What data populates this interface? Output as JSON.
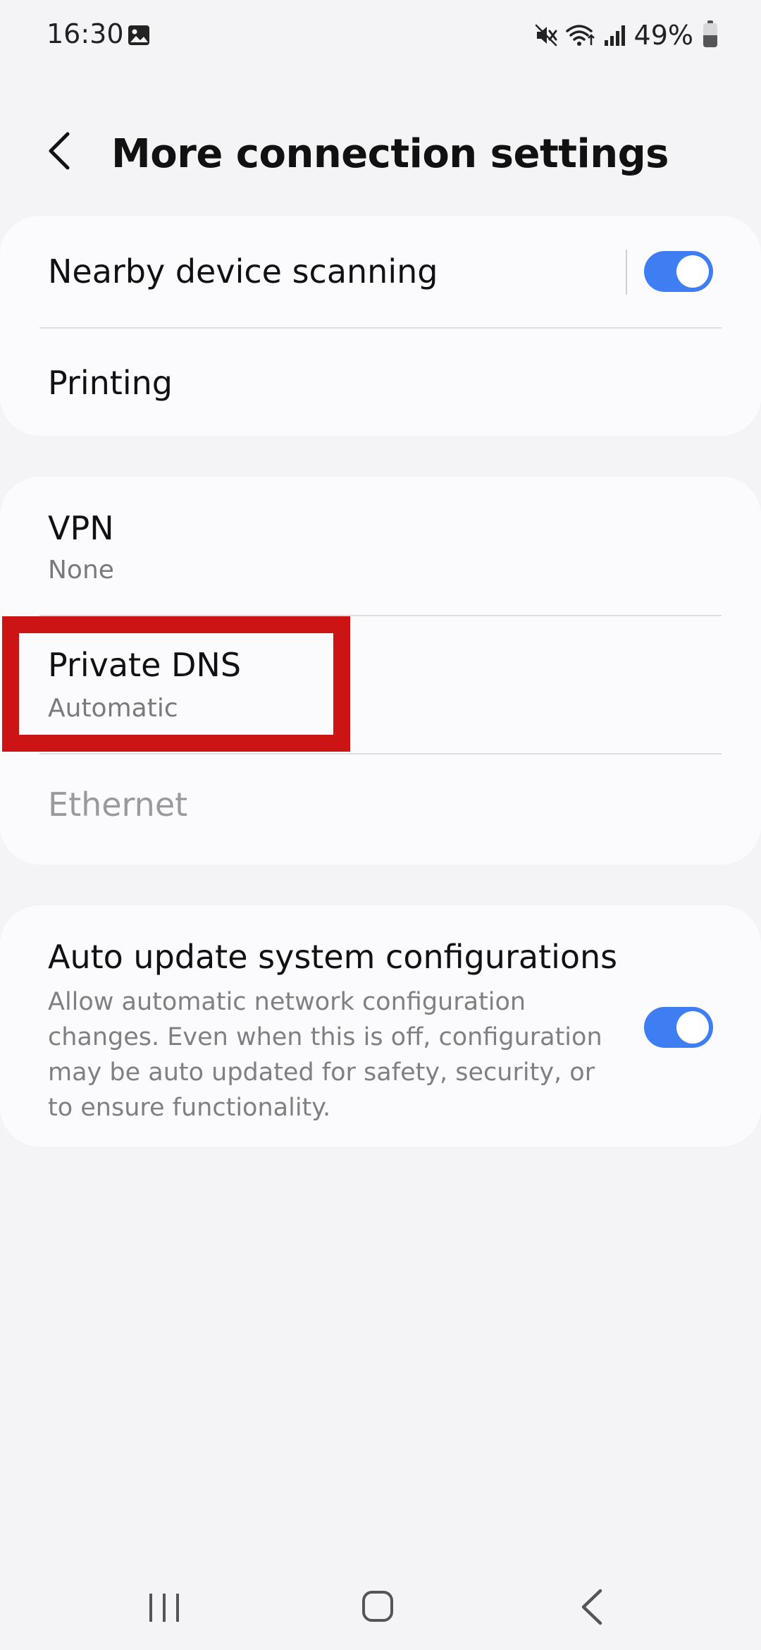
{
  "status_bar": {
    "time": "16:30",
    "battery_percent": "49%",
    "battery_level": 0.49,
    "icons": [
      "gallery-icon",
      "mute-icon",
      "wifi-icon",
      "signal-icon",
      "battery-icon"
    ]
  },
  "header": {
    "title": "More connection settings",
    "back_icon": "chevron-left-icon"
  },
  "card1": {
    "nearby_device_scanning": {
      "label": "Nearby device scanning",
      "toggle_on": true
    },
    "printing": {
      "label": "Printing"
    }
  },
  "card2": {
    "vpn": {
      "label": "VPN",
      "value": "None"
    },
    "private_dns": {
      "label": "Private DNS",
      "value": "Automatic"
    },
    "ethernet": {
      "label": "Ethernet",
      "disabled": true
    }
  },
  "card3": {
    "auto_update": {
      "label": "Auto update system configurations",
      "description": "Allow automatic network configuration changes. Even when this is off, configuration may be auto updated for safety, security, or to ensure functionality.",
      "toggle_on": true
    }
  },
  "colors": {
    "accent": "#3f7ef2",
    "highlight": "#cc1414",
    "background": "#f4f4f6",
    "card": "#fbfbfd"
  },
  "nav_bar": {
    "icons": [
      "recents-icon",
      "home-icon",
      "back-icon"
    ]
  }
}
